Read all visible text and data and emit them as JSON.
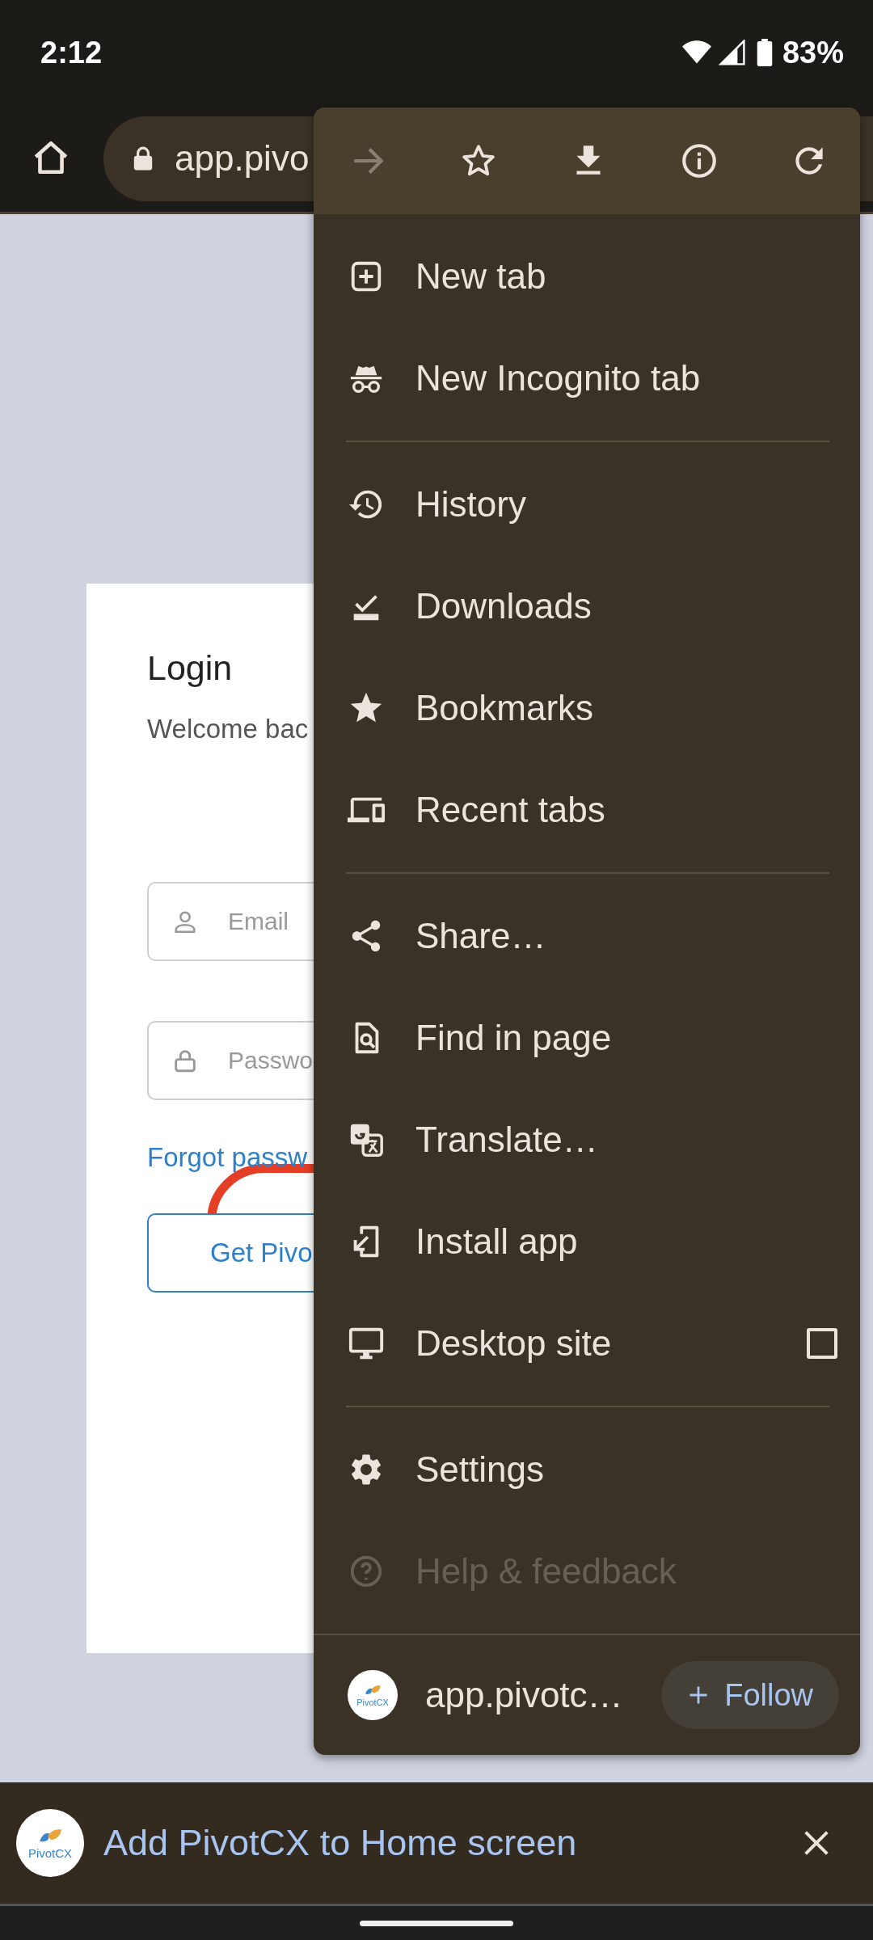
{
  "status_bar": {
    "time": "2:12",
    "battery": "83%"
  },
  "toolbar": {
    "url": "app.pivo"
  },
  "login": {
    "title": "Login",
    "subtitle": "Welcome bac",
    "fields": [
      {
        "placeholder": "Email"
      },
      {
        "placeholder": "Passwo"
      }
    ],
    "forgot_link": "Forgot passw",
    "submit_button": "Get Pivo"
  },
  "menu": {
    "top_actions": [
      {
        "disabled": true
      },
      {
        "disabled": false
      },
      {
        "disabled": false
      },
      {
        "disabled": false
      },
      {
        "disabled": false
      }
    ],
    "sections": [
      {
        "items": [
          {
            "label": "New tab",
            "kind": "plain"
          },
          {
            "label": "New Incognito tab",
            "kind": "plain"
          }
        ]
      },
      {
        "items": [
          {
            "label": "History",
            "kind": "plain"
          },
          {
            "label": "Downloads",
            "kind": "plain"
          },
          {
            "label": "Bookmarks",
            "kind": "plain"
          },
          {
            "label": "Recent tabs",
            "kind": "plain"
          }
        ]
      },
      {
        "items": [
          {
            "label": "Share…",
            "kind": "plain"
          },
          {
            "label": "Find in page",
            "kind": "plain"
          },
          {
            "label": "Translate…",
            "kind": "plain"
          },
          {
            "label": "Install app",
            "kind": "plain"
          },
          {
            "label": "Desktop site",
            "kind": "checkbox",
            "checked": false
          }
        ]
      },
      {
        "items": [
          {
            "label": "Settings",
            "kind": "plain"
          },
          {
            "label": "Help & feedback",
            "kind": "faded"
          }
        ]
      }
    ],
    "site": {
      "logo_text": "PivotCX",
      "name": "app.pivotc…",
      "follow_button": "Follow"
    }
  },
  "install_banner": {
    "logo_text": "PivotCX",
    "text": "Add PivotCX to Home screen"
  }
}
